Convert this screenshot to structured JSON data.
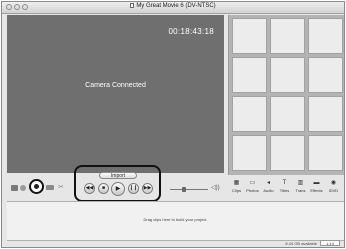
{
  "window": {
    "title": "My Great Movie 6 (DV-NTSC)"
  },
  "monitor": {
    "timecode": "00:18:43:18",
    "status": "Camera Connected"
  },
  "controls": {
    "import_label": "Import",
    "transport": [
      {
        "name": "rewind-button",
        "glyph": "◀◀"
      },
      {
        "name": "stop-button",
        "glyph": "■"
      },
      {
        "name": "play-button",
        "glyph": "▶"
      },
      {
        "name": "pause-button",
        "glyph": "❙❙"
      },
      {
        "name": "fast-forward-button",
        "glyph": "▶▶"
      }
    ]
  },
  "panels": [
    {
      "label": "Clips",
      "icon": "▦"
    },
    {
      "label": "Photos",
      "icon": "▭"
    },
    {
      "label": "Audio",
      "icon": "◂"
    },
    {
      "label": "Titles",
      "icon": "T"
    },
    {
      "label": "Trans",
      "icon": "▥"
    },
    {
      "label": "Effects",
      "icon": "▬"
    },
    {
      "label": "iDVD",
      "icon": "◉"
    }
  ],
  "timeline": {
    "hint": "Drag clips here to build your project."
  },
  "statusbar": {
    "disk": "8.44 GB available",
    "time": "1:14"
  }
}
